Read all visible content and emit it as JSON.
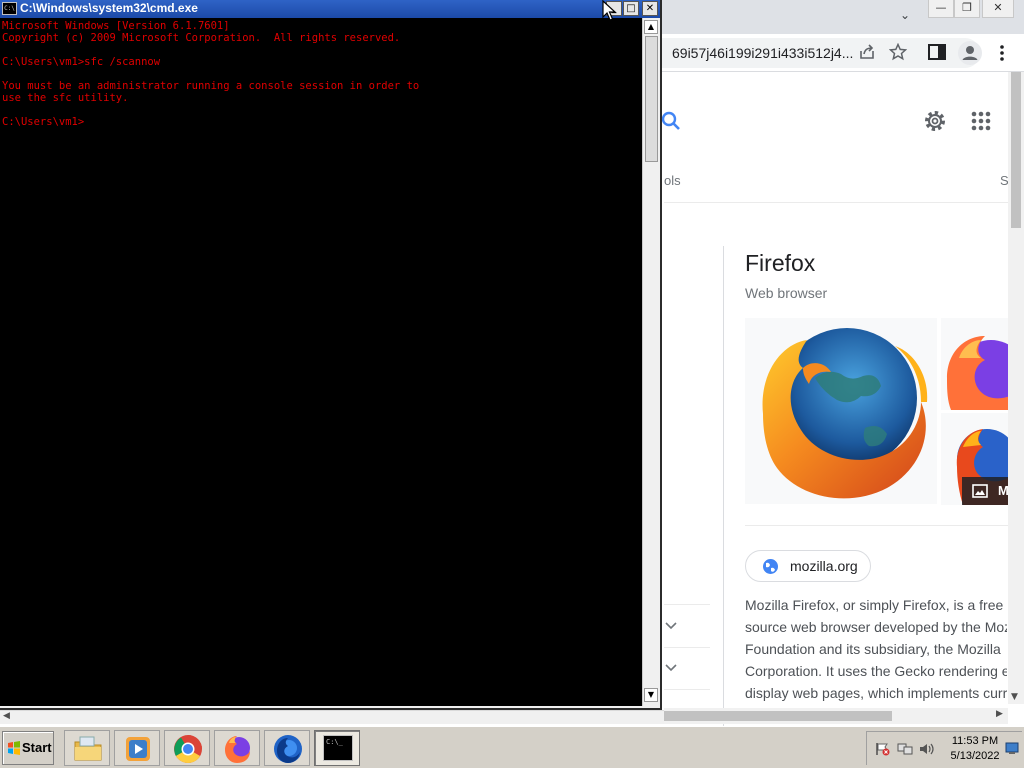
{
  "cmd": {
    "title": "C:\\Windows\\system32\\cmd.exe",
    "sysmenu_label": "C:\\",
    "buttons": {
      "minimize": "_",
      "maximize": "□",
      "close": "✕"
    },
    "lines": [
      "Microsoft Windows [Version 6.1.7601]",
      "Copyright (c) 2009 Microsoft Corporation.  All rights reserved.",
      "",
      "C:\\Users\\vm1>sfc /scannow",
      "",
      "You must be an administrator running a console session in order to",
      "use the sfc utility.",
      "",
      "C:\\Users\\vm1>"
    ],
    "text_color": "#e00000"
  },
  "chrome": {
    "url_fragment": "69i57j46i199i291i433i512j4...",
    "tabs_partial": {
      "tools": "ols",
      "next": "S"
    },
    "window_buttons": {
      "minimize": "—",
      "restore": "❐",
      "close": "✕"
    },
    "tab_menu": "⌄"
  },
  "knowledge_panel": {
    "title": "Firefox",
    "subtitle": "Web browser",
    "more_images_label": "M",
    "website_chip": "mozilla.org",
    "description_lines": [
      "Mozilla Firefox, or simply Firefox, is a free",
      "source web browser developed by the Moz",
      "Foundation and its subsidiary, the Mozilla",
      "Corporation. It uses the Gecko rendering e",
      "display web pages, which implements curr"
    ]
  },
  "taskbar": {
    "start_label": "Start",
    "apps": [
      {
        "name": "windows-explorer",
        "icon": "folder-icon"
      },
      {
        "name": "media-player",
        "icon": "media-player-icon"
      },
      {
        "name": "google-chrome",
        "icon": "chrome-icon"
      },
      {
        "name": "firefox",
        "icon": "firefox-icon"
      },
      {
        "name": "firefox-developer",
        "icon": "firefox-blue-icon"
      },
      {
        "name": "command-prompt",
        "icon": "cmd-icon",
        "active": true
      }
    ],
    "cmd_icon_text": "C:\\_",
    "clock_time": "11:53 PM",
    "clock_date": "5/13/2022"
  },
  "colors": {
    "cmd_title_bar": "#1c4aa8",
    "console_bg": "#000000",
    "console_text": "#e00000",
    "google_blue": "#4285f4",
    "taskbar": "#d4d0c8"
  }
}
